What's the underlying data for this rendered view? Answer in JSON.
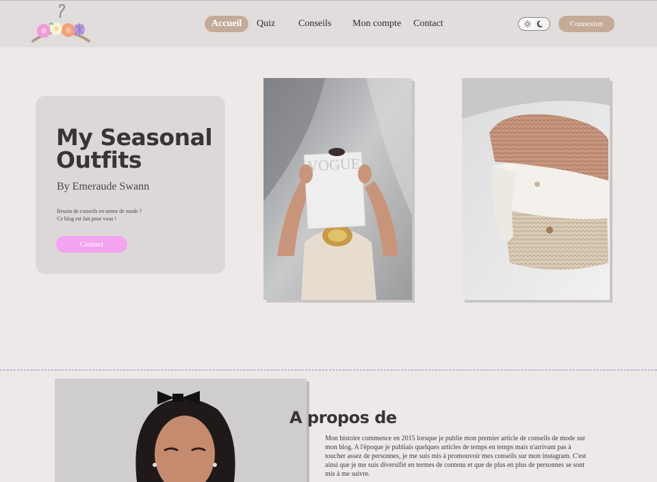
{
  "header": {
    "logo_icon": "clothes-hanger-flowers-icon",
    "nav": [
      {
        "label": "Accueil",
        "active": true
      },
      {
        "label": "Quiz",
        "active": false
      },
      {
        "label": "Conseils",
        "active": false
      },
      {
        "label": "Mon compte",
        "active": false
      },
      {
        "label": "Contact",
        "active": false
      }
    ],
    "theme_toggle": {
      "light_icon": "sun-icon",
      "dark_icon": "moon-icon",
      "selected": "light"
    },
    "login_label": "Connexion"
  },
  "hero": {
    "title_line1": "My Seasonal",
    "title_line2": "Outfits",
    "author": "By Emeraude Swann",
    "text_line1": "Besoin de conseils en terme de mode ?",
    "text_line2": "Ce blog est fait pour vous !",
    "contact_label": "Contact"
  },
  "photos": [
    {
      "name": "vogue-magazine-photo",
      "watermark": "VOGUE"
    },
    {
      "name": "sweaters-stack-photo"
    }
  ],
  "about": {
    "title": "A propos de",
    "lines": [
      "Mon histoire commence en 2015 lorsque je publie mon premier article de conseils de mode sur",
      "mon blog. A l'époque je publiais quelques articles de temps en temps mais n'arrivant pas à",
      "toucher assez de personnes, je me suis mis à promouvoir mes conseils sur mon instagram. C'est",
      "ainsi que je me suis diversifié en termes de contenu et que de plus en plus de personnes se sont",
      "mis à me suivre."
    ]
  },
  "colors": {
    "background": "#ede9e8",
    "header_bg": "#e1dddc",
    "accent_beige": "#c4ab98",
    "accent_pink": "#f4a4f1",
    "divider_blue": "#7f86c4"
  }
}
